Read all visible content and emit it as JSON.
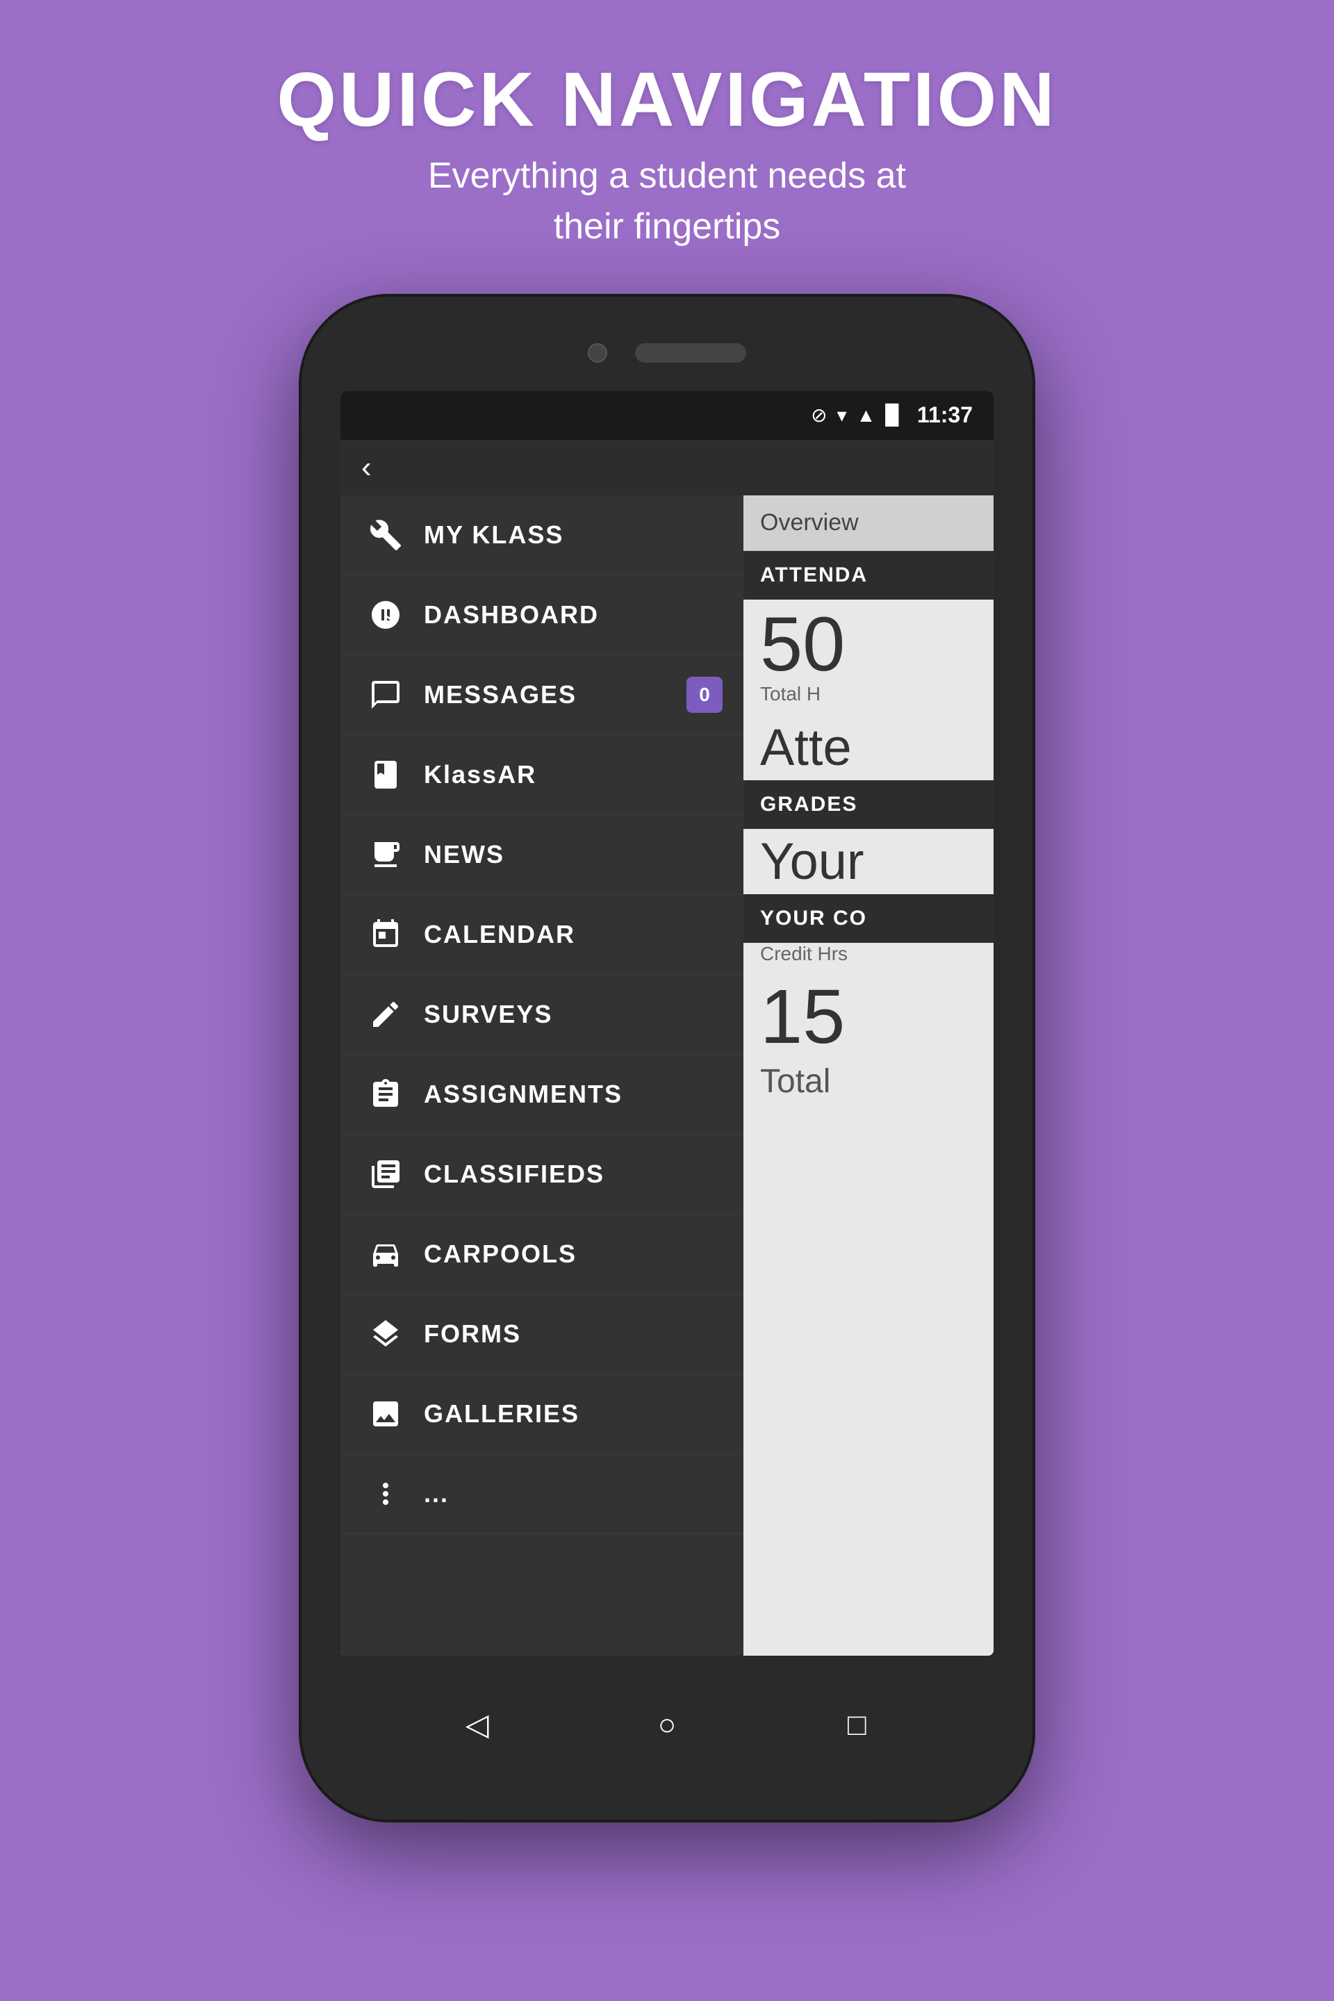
{
  "header": {
    "title": "QUICK NAVIGATION",
    "subtitle": "Everything a student needs at\ntheir fingertips"
  },
  "statusBar": {
    "time": "11:37",
    "icons": [
      "⊘",
      "▾",
      "▲",
      "▉"
    ]
  },
  "navBar": {
    "backLabel": "‹"
  },
  "rightPanel": {
    "overviewTab": "Overview",
    "sections": [
      {
        "header": "ATTENDA",
        "bigNumber": "50",
        "subLabel": "Total H",
        "bodyText": "Atte"
      },
      {
        "header": "GRADES",
        "bodyText": "Your"
      },
      {
        "header": "YOUR CO",
        "creditLabel": "Credit Hrs",
        "bigNumber": "15",
        "totalText": "Total"
      }
    ]
  },
  "sidebar": {
    "items": [
      {
        "id": "my-klass",
        "label": "MY KLASS",
        "icon": "wrench",
        "badge": null
      },
      {
        "id": "dashboard",
        "label": "DASHBOARD",
        "icon": "gauge",
        "badge": null
      },
      {
        "id": "messages",
        "label": "MESSAGES",
        "icon": "chat",
        "badge": "0"
      },
      {
        "id": "klassar",
        "label": "KlassAR",
        "icon": "book",
        "badge": null
      },
      {
        "id": "news",
        "label": "NEWS",
        "icon": "newspaper",
        "badge": null
      },
      {
        "id": "calendar",
        "label": "CALENDAR",
        "icon": "calendar",
        "badge": null
      },
      {
        "id": "surveys",
        "label": "SURVEYS",
        "icon": "pencil",
        "badge": null
      },
      {
        "id": "assignments",
        "label": "ASSIGNMENTS",
        "icon": "clipboard",
        "badge": null
      },
      {
        "id": "classifieds",
        "label": "CLASSIFIEDS",
        "icon": "list",
        "badge": null
      },
      {
        "id": "carpools",
        "label": "CARPOOLS",
        "icon": "car",
        "badge": null
      },
      {
        "id": "forms",
        "label": "FORMS",
        "icon": "layers",
        "badge": null
      },
      {
        "id": "galleries",
        "label": "GALLERIES",
        "icon": "photo",
        "badge": null
      },
      {
        "id": "more",
        "label": "...",
        "icon": "dots",
        "badge": null
      }
    ]
  },
  "phoneBottom": {
    "backBtn": "◁",
    "homeBtn": "○",
    "recentBtn": "□"
  },
  "colors": {
    "background": "#9b6ec8",
    "phoneBg": "#2a2a2a",
    "sidebarBg": "#333333",
    "badgeColor": "#7c5cbf",
    "sectionHeaderBg": "#2d2d2d"
  }
}
